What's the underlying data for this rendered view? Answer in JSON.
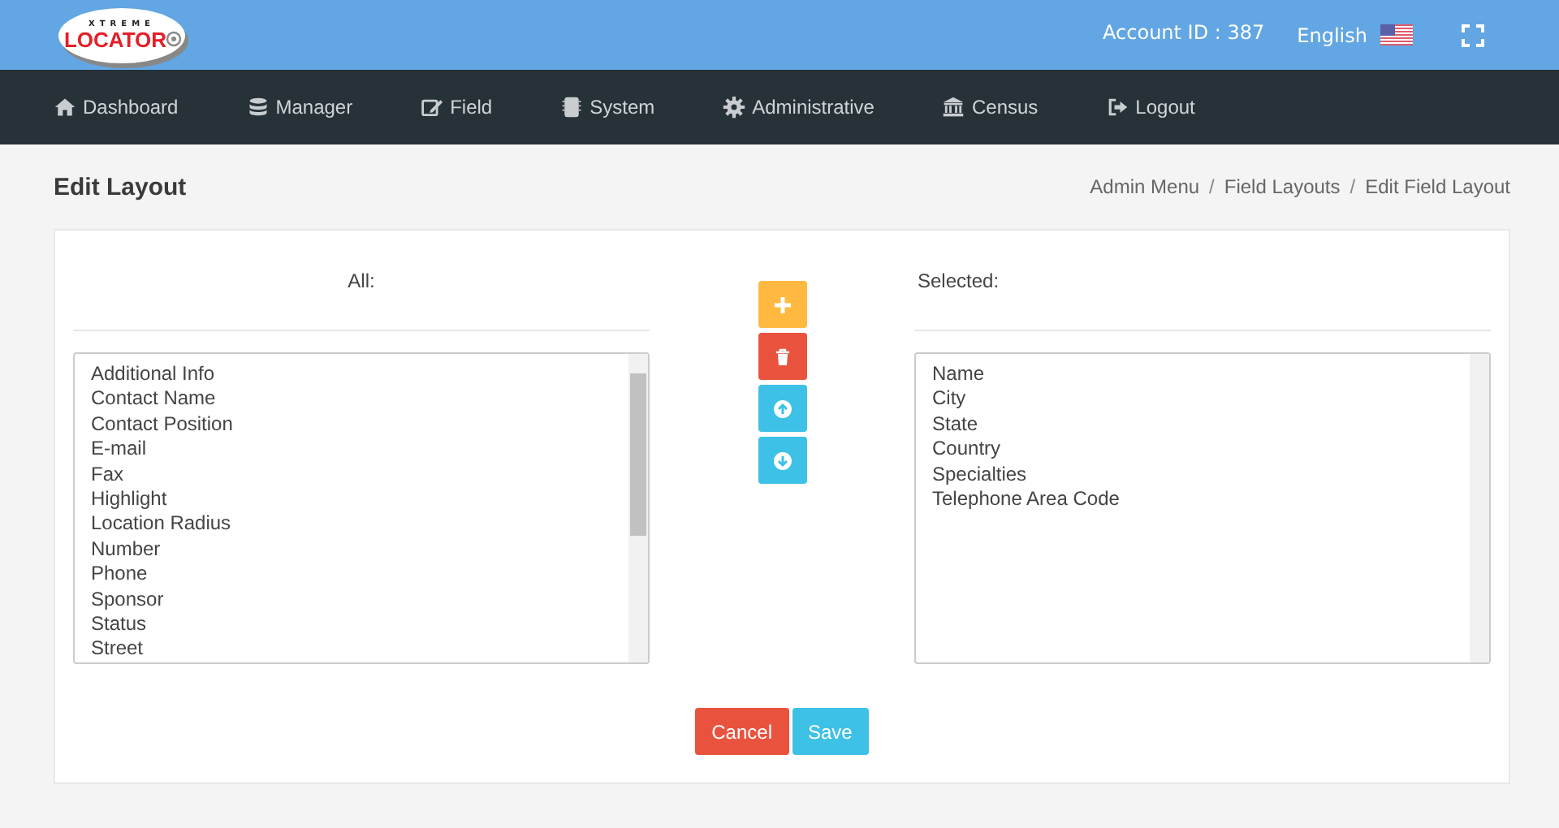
{
  "header": {
    "logo": {
      "top": "XTREME",
      "main": "LOCATOR"
    },
    "account": "Account ID : 387",
    "language": "English"
  },
  "nav": [
    {
      "label": "Dashboard"
    },
    {
      "label": "Manager"
    },
    {
      "label": "Field"
    },
    {
      "label": "System"
    },
    {
      "label": "Administrative"
    },
    {
      "label": "Census"
    },
    {
      "label": "Logout"
    }
  ],
  "page_title": "Edit Layout",
  "breadcrumb": [
    {
      "kind": "link",
      "text": "Admin Menu"
    },
    {
      "kind": "separator",
      "text": "/"
    },
    {
      "kind": "link",
      "text": "Field Layouts"
    },
    {
      "kind": "separator",
      "text": "/"
    },
    {
      "kind": "link",
      "text": "Edit Field Layout"
    }
  ],
  "all_list": {
    "label": "All:",
    "items": [
      "Additional Info",
      "Contact Name",
      "Contact Position",
      "E-mail",
      "Fax",
      "Highlight",
      "Location Radius",
      "Number",
      "Phone",
      "Sponsor",
      "Status",
      "Street"
    ]
  },
  "move_buttons": [
    {
      "kind": "add"
    },
    {
      "kind": "remove"
    },
    {
      "kind": "up"
    },
    {
      "kind": "down"
    }
  ],
  "selected_list": {
    "label": "Selected:",
    "items": [
      "Name",
      "City",
      "State",
      "Country",
      "Specialties",
      "Telephone Area Code"
    ]
  },
  "actions": [
    {
      "label": "Cancel",
      "kind": "cancel"
    },
    {
      "label": "Save",
      "kind": "save"
    }
  ]
}
